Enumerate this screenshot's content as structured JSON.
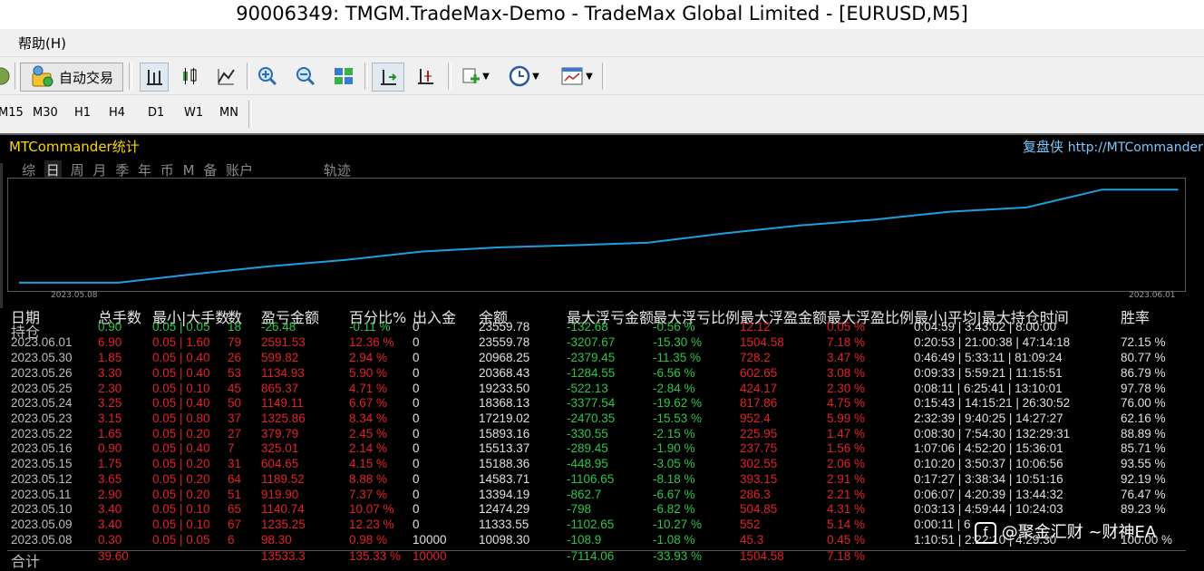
{
  "window": {
    "title": "90006349: TMGM.TradeMax-Demo - TradeMax Global Limited - [EURUSD,M5]"
  },
  "menu": {
    "help": "帮助(H)"
  },
  "toolbar": {
    "auto_trading": "自动交易",
    "timeframes": [
      "M15",
      "M30",
      "H1",
      "H4",
      "D1",
      "W1",
      "MN"
    ]
  },
  "panel": {
    "title": "MTCommander统计",
    "brand": "复盘侠",
    "url": "http://MTCommander",
    "tabs": [
      "综",
      "日",
      "周",
      "月",
      "季",
      "年",
      "币",
      "M",
      "备",
      "账户",
      "轨迹"
    ],
    "active_tab": "日"
  },
  "chart_data": {
    "type": "line",
    "x": [
      "2023.05.08",
      "2023.05.09",
      "2023.05.10",
      "2023.05.11",
      "2023.05.12",
      "2023.05.15",
      "2023.05.16",
      "2023.05.22",
      "2023.05.23",
      "2023.05.24",
      "2023.05.25",
      "2023.05.26",
      "2023.05.30",
      "2023.06.01",
      "持仓"
    ],
    "series": [
      {
        "values": [
          10098.3,
          11333.55,
          12474.29,
          13394.19,
          14583.71,
          15188.36,
          15513.37,
          15893.16,
          17219.02,
          18368.13,
          19233.5,
          20368.43,
          20968.25,
          23559.78,
          23559.78
        ]
      }
    ],
    "x_tick_start": "2023.05.08",
    "x_tick_end": "2023.06.01",
    "color": "#1e9fe0"
  },
  "table": {
    "headers": [
      "日期",
      "总手数",
      "最小|大手数",
      "数",
      "盈亏金额",
      "百分比%",
      "出入金",
      "余额",
      "最大浮亏金额",
      "最大浮亏比例",
      "最大浮盈金额",
      "最大浮盈比例",
      "最小|平均|最大持仓时间",
      "胜率"
    ],
    "holding": {
      "label": "持仓",
      "lots": "0.90",
      "minmax": "0.05 | 0.05",
      "count": "18",
      "pnl": "-26.48",
      "pct": "-0.11 %",
      "inout": "0",
      "balance": "23559.78",
      "maxloss": "-132.68",
      "maxloss_pct": "-0.56 %",
      "maxprofit": "12.12",
      "maxprofit_pct": "0.05 %",
      "times": "0:04:59 | 3:43:02 | 8:00:00",
      "winrate": ""
    },
    "rows": [
      {
        "date": "2023.06.01",
        "lots": "6.90",
        "minmax": "0.05 | 1.60",
        "count": "79",
        "pnl": "2591.53",
        "pct": "12.36 %",
        "inout": "0",
        "balance": "23559.78",
        "maxloss": "-3207.67",
        "maxloss_pct": "-15.30 %",
        "maxprofit": "1504.58",
        "maxprofit_pct": "7.18 %",
        "times": "0:20:53 | 21:00:38 | 47:14:18",
        "winrate": "72.15 %"
      },
      {
        "date": "2023.05.30",
        "lots": "1.85",
        "minmax": "0.05 | 0.40",
        "count": "26",
        "pnl": "599.82",
        "pct": "2.94 %",
        "inout": "0",
        "balance": "20968.25",
        "maxloss": "-2379.45",
        "maxloss_pct": "-11.35 %",
        "maxprofit": "728.2",
        "maxprofit_pct": "3.47 %",
        "times": "0:46:49 | 5:33:11 | 81:09:24",
        "winrate": "80.77 %"
      },
      {
        "date": "2023.05.26",
        "lots": "3.30",
        "minmax": "0.05 | 0.40",
        "count": "53",
        "pnl": "1134.93",
        "pct": "5.90 %",
        "inout": "0",
        "balance": "20368.43",
        "maxloss": "-1284.55",
        "maxloss_pct": "-6.56 %",
        "maxprofit": "602.65",
        "maxprofit_pct": "3.08 %",
        "times": "0:09:33 | 5:59:21 | 11:15:51",
        "winrate": "86.79 %"
      },
      {
        "date": "2023.05.25",
        "lots": "2.30",
        "minmax": "0.05 | 0.10",
        "count": "45",
        "pnl": "865.37",
        "pct": "4.71 %",
        "inout": "0",
        "balance": "19233.50",
        "maxloss": "-522.13",
        "maxloss_pct": "-2.84 %",
        "maxprofit": "424.17",
        "maxprofit_pct": "2.30 %",
        "times": "0:08:11 | 6:25:41 | 13:10:01",
        "winrate": "97.78 %"
      },
      {
        "date": "2023.05.24",
        "lots": "3.25",
        "minmax": "0.05 | 0.40",
        "count": "50",
        "pnl": "1149.11",
        "pct": "6.67 %",
        "inout": "0",
        "balance": "18368.13",
        "maxloss": "-3377.54",
        "maxloss_pct": "-19.62 %",
        "maxprofit": "817.86",
        "maxprofit_pct": "4.75 %",
        "times": "0:15:43 | 14:15:21 | 26:30:52",
        "winrate": "76.00 %"
      },
      {
        "date": "2023.05.23",
        "lots": "3.15",
        "minmax": "0.05 | 0.80",
        "count": "37",
        "pnl": "1325.86",
        "pct": "8.34 %",
        "inout": "0",
        "balance": "17219.02",
        "maxloss": "-2470.35",
        "maxloss_pct": "-15.53 %",
        "maxprofit": "952.4",
        "maxprofit_pct": "5.99 %",
        "times": "2:32:39 | 9:40:25 | 14:27:27",
        "winrate": "62.16 %"
      },
      {
        "date": "2023.05.22",
        "lots": "1.65",
        "minmax": "0.05 | 0.20",
        "count": "27",
        "pnl": "379.79",
        "pct": "2.45 %",
        "inout": "0",
        "balance": "15893.16",
        "maxloss": "-330.55",
        "maxloss_pct": "-2.15 %",
        "maxprofit": "225.95",
        "maxprofit_pct": "1.47 %",
        "times": "0:08:30 | 7:54:30 | 132:29:31",
        "winrate": "88.89 %"
      },
      {
        "date": "2023.05.16",
        "lots": "0.90",
        "minmax": "0.05 | 0.40",
        "count": "7",
        "pnl": "325.01",
        "pct": "2.14 %",
        "inout": "0",
        "balance": "15513.37",
        "maxloss": "-289.45",
        "maxloss_pct": "-1.90 %",
        "maxprofit": "237.75",
        "maxprofit_pct": "1.56 %",
        "times": "1:07:06 | 4:52:20 | 15:36:01",
        "winrate": "85.71 %"
      },
      {
        "date": "2023.05.15",
        "lots": "1.75",
        "minmax": "0.05 | 0.20",
        "count": "31",
        "pnl": "604.65",
        "pct": "4.15 %",
        "inout": "0",
        "balance": "15188.36",
        "maxloss": "-448.95",
        "maxloss_pct": "-3.05 %",
        "maxprofit": "302.55",
        "maxprofit_pct": "2.06 %",
        "times": "0:10:20 | 3:50:37 | 10:06:56",
        "winrate": "93.55 %"
      },
      {
        "date": "2023.05.12",
        "lots": "3.65",
        "minmax": "0.05 | 0.20",
        "count": "64",
        "pnl": "1189.52",
        "pct": "8.88 %",
        "inout": "0",
        "balance": "14583.71",
        "maxloss": "-1106.65",
        "maxloss_pct": "-8.18 %",
        "maxprofit": "393.15",
        "maxprofit_pct": "2.91 %",
        "times": "0:17:27 | 3:38:34 | 10:51:16",
        "winrate": "92.19 %"
      },
      {
        "date": "2023.05.11",
        "lots": "2.90",
        "minmax": "0.05 | 0.20",
        "count": "51",
        "pnl": "919.90",
        "pct": "7.37 %",
        "inout": "0",
        "balance": "13394.19",
        "maxloss": "-862.7",
        "maxloss_pct": "-6.67 %",
        "maxprofit": "286.3",
        "maxprofit_pct": "2.21 %",
        "times": "0:06:07 | 4:20:39 | 13:44:32",
        "winrate": "76.47 %"
      },
      {
        "date": "2023.05.10",
        "lots": "3.40",
        "minmax": "0.05 | 0.10",
        "count": "65",
        "pnl": "1140.74",
        "pct": "10.07 %",
        "inout": "0",
        "balance": "12474.29",
        "maxloss": "-798",
        "maxloss_pct": "-6.82 %",
        "maxprofit": "504.85",
        "maxprofit_pct": "4.31 %",
        "times": "0:03:13 | 4:59:44 | 10:24:03",
        "winrate": "89.23 %"
      },
      {
        "date": "2023.05.09",
        "lots": "3.40",
        "minmax": "0.05 | 0.10",
        "count": "67",
        "pnl": "1235.25",
        "pct": "12.23 %",
        "inout": "0",
        "balance": "11333.55",
        "maxloss": "-1102.65",
        "maxloss_pct": "-10.27 %",
        "maxprofit": "552",
        "maxprofit_pct": "5.14 %",
        "times": "0:00:11 | 6",
        "winrate": ""
      },
      {
        "date": "2023.05.08",
        "lots": "0.30",
        "minmax": "0.05 | 0.05",
        "count": "6",
        "pnl": "98.30",
        "pct": "0.98 %",
        "inout": "10000",
        "balance": "10098.30",
        "maxloss": "-108.9",
        "maxloss_pct": "-1.08 %",
        "maxprofit": "45.3",
        "maxprofit_pct": "0.45 %",
        "times": "1:10:51 | 2:22:10 | 4:29:30",
        "winrate": "100.00 %"
      }
    ],
    "total": {
      "label": "合计",
      "lots": "39.60",
      "pnl": "13533.3",
      "pct": "135.33 %",
      "inout": "10000",
      "maxloss": "-7114.06",
      "maxloss_pct": "-33.93 %",
      "maxprofit": "1504.58",
      "maxprofit_pct": "7.18 %"
    }
  },
  "watermark": "@聚金汇财 ~财神EA",
  "colors": {
    "positive": "#2ec44a",
    "negative": "#e2222a",
    "line": "#1e9fe0",
    "title": "#ffd700",
    "brand": "#7ec8ff"
  }
}
